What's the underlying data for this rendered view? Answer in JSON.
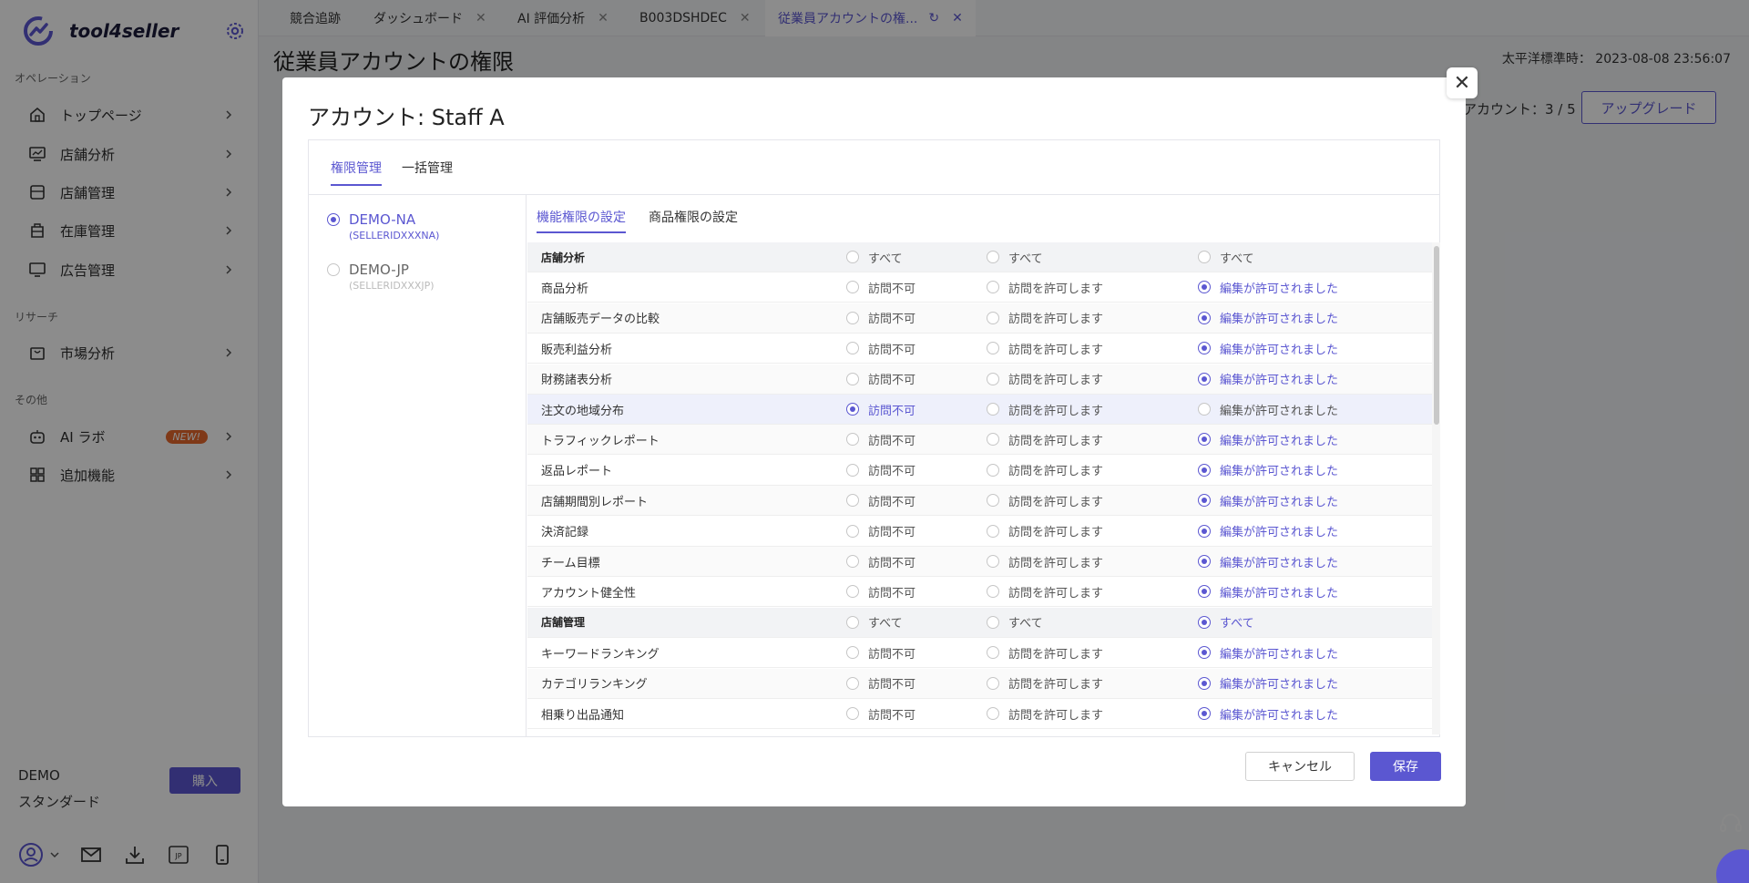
{
  "brand": {
    "name": "tool4seller"
  },
  "sidebar": {
    "sections": [
      {
        "label": "オペレーション"
      },
      {
        "label": "リサーチ"
      },
      {
        "label": "その他"
      }
    ],
    "items": [
      {
        "label": "トップページ",
        "icon": "home-icon"
      },
      {
        "label": "店舗分析",
        "icon": "chart-icon"
      },
      {
        "label": "店舗管理",
        "icon": "store-icon"
      },
      {
        "label": "在庫管理",
        "icon": "box-icon"
      },
      {
        "label": "広告管理",
        "icon": "monitor-icon"
      },
      {
        "label": "市場分析",
        "icon": "bag-icon"
      },
      {
        "label": "AI ラボ",
        "icon": "robot-icon",
        "badge": "NEW!"
      },
      {
        "label": "追加機能",
        "icon": "grid-icon"
      }
    ],
    "footer": {
      "name": "DEMO",
      "plan": "スタンダード",
      "buy_label": "購入",
      "lang_badge": "JP"
    }
  },
  "tabs": [
    {
      "label": "競合追跡"
    },
    {
      "label": "ダッシュボード"
    },
    {
      "label": "AI 評価分析"
    },
    {
      "label": "B003DSHDEC"
    },
    {
      "label": "従業員アカウントの権..."
    }
  ],
  "page": {
    "title": "従業員アカウントの権限",
    "timezone": "太平洋標準時： 2023-08-08 23:56:07",
    "account_count": "アカウント：3 / 5",
    "upgrade_label": "アップグレード"
  },
  "modal": {
    "title": "アカウント:  Staff A",
    "tabs": [
      "権限管理",
      "一括管理"
    ],
    "accounts": [
      {
        "name": "DEMO-NA",
        "id": "(SELLERIDXXXNA)",
        "selected": true
      },
      {
        "name": "DEMO-JP",
        "id": "(SELLERIDXXXJP)",
        "selected": false
      }
    ],
    "subtabs": [
      "機能権限の設定",
      "商品権限の設定"
    ],
    "options": {
      "all": "すべて",
      "no_access": "訪問不可",
      "access": "訪問を許可します",
      "edit": "編集が許可されました"
    },
    "rows": [
      {
        "type": "group",
        "name": "店舗分析",
        "selected": -1
      },
      {
        "type": "item",
        "name": "商品分析",
        "selected": 2
      },
      {
        "type": "item",
        "name": "店舗販売データの比較",
        "selected": 2
      },
      {
        "type": "item",
        "name": "販売利益分析",
        "selected": 2
      },
      {
        "type": "item",
        "name": "財務諸表分析",
        "selected": 2
      },
      {
        "type": "item",
        "name": "注文の地域分布",
        "selected": 0
      },
      {
        "type": "item",
        "name": "トラフィックレポート",
        "selected": 2
      },
      {
        "type": "item",
        "name": "返品レポート",
        "selected": 2
      },
      {
        "type": "item",
        "name": "店舗期間別レポート",
        "selected": 2
      },
      {
        "type": "item",
        "name": "決済記録",
        "selected": 2
      },
      {
        "type": "item",
        "name": "チーム目標",
        "selected": 2
      },
      {
        "type": "item",
        "name": "アカウント健全性",
        "selected": 2
      },
      {
        "type": "group",
        "name": "店舗管理",
        "selected": 2
      },
      {
        "type": "item",
        "name": "キーワードランキング",
        "selected": 2
      },
      {
        "type": "item",
        "name": "カテゴリランキング",
        "selected": 2
      },
      {
        "type": "item",
        "name": "相乗り出品通知",
        "selected": 2
      }
    ],
    "cancel_label": "キャンセル",
    "save_label": "保存"
  },
  "colors": {
    "accent": "#5b57d1",
    "badge": "#e8692c"
  }
}
